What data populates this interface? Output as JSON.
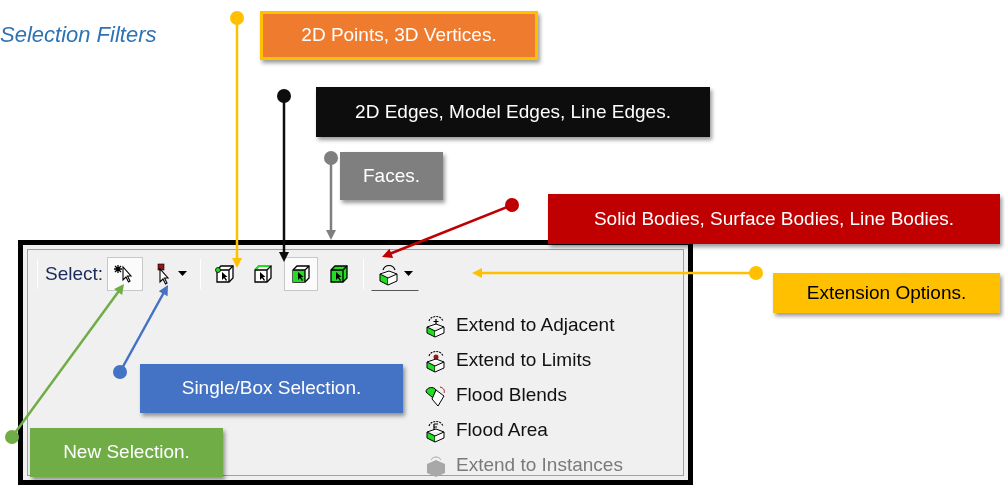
{
  "title": "Selection Filters",
  "callouts": [
    {
      "text": "2D Points, 3D Vertices.",
      "color": "#ef7b2f"
    },
    {
      "text": "2D Edges, Model Edges, Line Edges.",
      "color": "#0d0d0d"
    },
    {
      "text": "Faces.",
      "color": "#7f7f7f"
    },
    {
      "text": "Solid Bodies, Surface Bodies, Line Bodies.",
      "color": "#c00000"
    },
    {
      "text": "Extension Options.",
      "color": "#ffc000"
    },
    {
      "text": "Single/Box Selection.",
      "color": "#4472c4"
    },
    {
      "text": "New Selection.",
      "color": "#70ad47"
    }
  ],
  "toolbar": {
    "label": "Select:",
    "buttons": [
      {
        "kind": "new",
        "pressed": true
      },
      {
        "kind": "single",
        "pressed": false
      },
      {
        "kind": "points",
        "pressed": false
      },
      {
        "kind": "edges",
        "pressed": false
      },
      {
        "kind": "faces",
        "pressed": true
      },
      {
        "kind": "bodies",
        "pressed": false
      },
      {
        "kind": "extend",
        "pressed": false
      }
    ]
  },
  "menu": [
    {
      "kind": "adjacent",
      "label": "Extend to Adjacent",
      "disabled": false
    },
    {
      "kind": "limits",
      "label": "Extend to Limits",
      "disabled": false
    },
    {
      "kind": "blends",
      "label": "Flood Blends",
      "disabled": false
    },
    {
      "kind": "area",
      "label": "Flood Area",
      "disabled": false
    },
    {
      "kind": "instances",
      "label": "Extend to Instances",
      "disabled": true
    }
  ]
}
